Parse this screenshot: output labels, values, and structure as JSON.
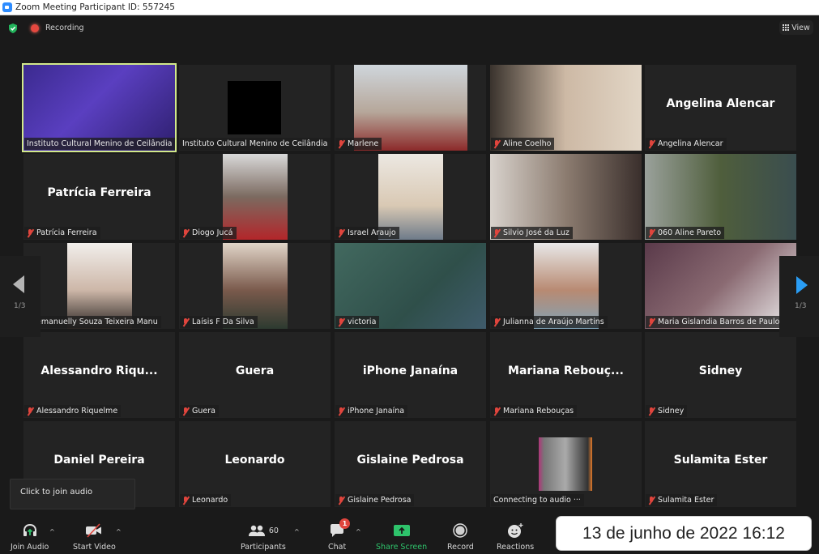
{
  "window": {
    "title": "Zoom Meeting Participant ID: 557245"
  },
  "topbar": {
    "security_icon": "shield-check-icon",
    "recording_label": "Recording",
    "view_label": "View"
  },
  "colors": {
    "active_speaker_border": "#d2e98a",
    "muted_icon": "#e0453d",
    "share_screen": "#2ec36b",
    "nav_arrow_active": "#2a9df4",
    "recording_dot": "#e5483f"
  },
  "pagination": {
    "current": "1/3"
  },
  "participants": [
    {
      "label": "Instituto Cultural Menino de Ceilândia",
      "muted": false,
      "video": true,
      "active": true
    },
    {
      "label": "Instituto Cultural Menino de Ceilândia",
      "muted": false,
      "video": true,
      "avatar": "clown-logo"
    },
    {
      "label": "Marlene",
      "muted": true,
      "video": true
    },
    {
      "label": "Aline Coelho",
      "muted": true,
      "video": true
    },
    {
      "label": "Angelina Alencar",
      "display_name": "Angelina Alencar",
      "muted": true,
      "video": false
    },
    {
      "label": "Patrícia Ferreira",
      "display_name": "Patrícia Ferreira",
      "muted": true,
      "video": false
    },
    {
      "label": "Diogo Jucá",
      "muted": true,
      "video": true
    },
    {
      "label": "Israel Araujo",
      "muted": true,
      "video": true
    },
    {
      "label": "Silvio José da Luz",
      "muted": true,
      "video": true
    },
    {
      "label": "060 Aline Pareto",
      "muted": true,
      "video": true
    },
    {
      "label": "emanuelly Souza Teixeira Manu",
      "muted": true,
      "video": true
    },
    {
      "label": "Laísis F Da Silva",
      "muted": true,
      "video": true
    },
    {
      "label": "victoria",
      "muted": true,
      "video": true
    },
    {
      "label": "Julianna de Araújo Martins",
      "muted": true,
      "video": true
    },
    {
      "label": "Maria Gislandia Barros de Paulo",
      "muted": true,
      "video": true
    },
    {
      "label": "Alessandro Riquelme",
      "display_name": "Alessandro  Riqu...",
      "muted": true,
      "video": false
    },
    {
      "label": "Guera",
      "display_name": "Guera",
      "muted": true,
      "video": false
    },
    {
      "label": "iPhone Janaína",
      "display_name": "iPhone Janaína",
      "muted": true,
      "video": false
    },
    {
      "label": "Mariana Rebouças",
      "display_name": "Mariana  Rebouç...",
      "muted": true,
      "video": false
    },
    {
      "label": "Sidney",
      "display_name": "Sidney",
      "muted": true,
      "video": false
    },
    {
      "label": "",
      "display_name": "Daniel Pereira",
      "muted": false,
      "video": false
    },
    {
      "label": "Leonardo",
      "display_name": "Leonardo",
      "muted": true,
      "video": false
    },
    {
      "label": "Gislaine Pedrosa",
      "display_name": "Gislaine Pedrosa",
      "muted": true,
      "video": false
    },
    {
      "label": "Connecting to audio ···",
      "muted": false,
      "video": false,
      "avatar": "profile-photo"
    },
    {
      "label": "Sulamita Ester",
      "display_name": "Sulamita Ester",
      "muted": true,
      "video": false
    }
  ],
  "tooltip": {
    "text": "Click to join audio"
  },
  "toolbar": {
    "join_audio": "Join Audio",
    "start_video": "Start Video",
    "participants": "Participants",
    "participants_count": "60",
    "chat": "Chat",
    "chat_badge": "1",
    "share_screen": "Share Screen",
    "record": "Record",
    "reactions": "Reactions"
  },
  "overlay": {
    "datestamp": "13 de junho de 2022 16:12"
  }
}
